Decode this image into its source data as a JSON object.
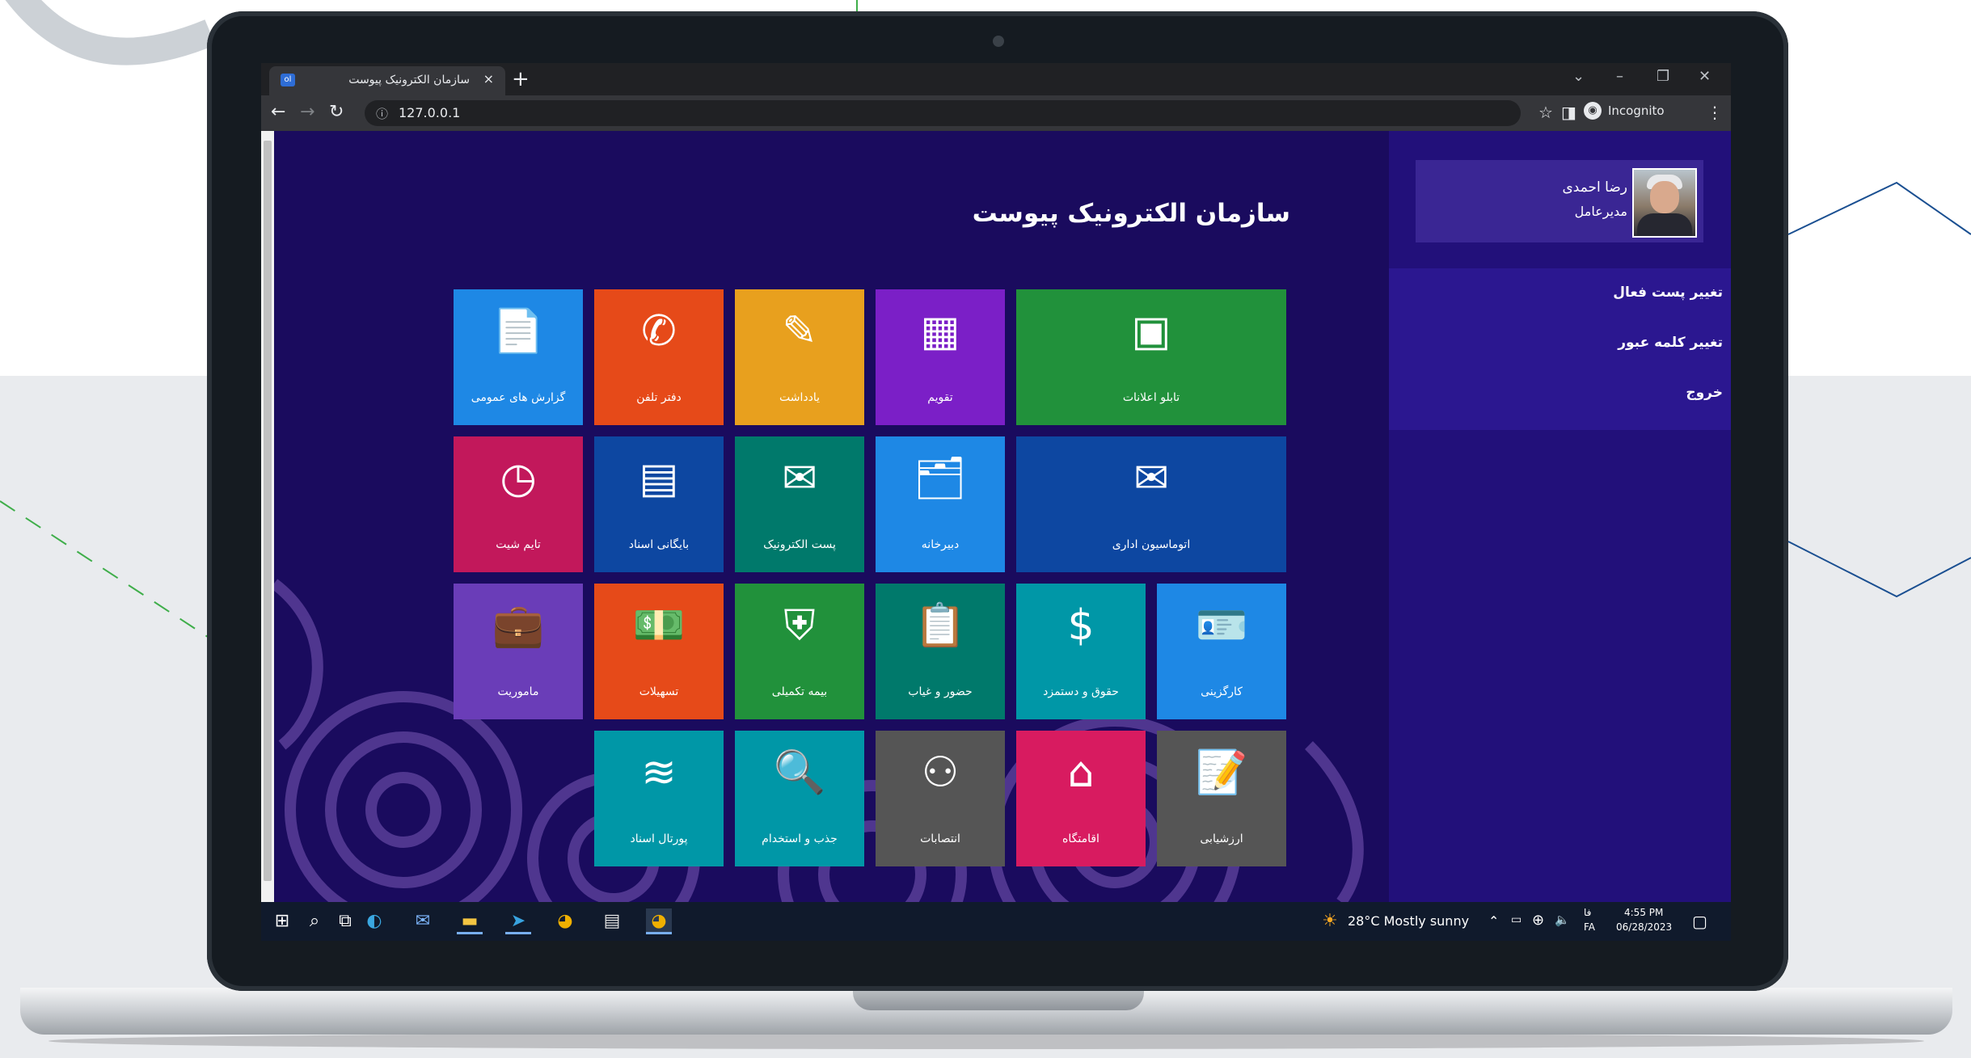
{
  "browser": {
    "tab_title": "سازمان الکترونیک پیوست",
    "tab_favicon": "ol",
    "tab_close": "×",
    "new_tab": "+",
    "url": "127.0.0.1",
    "incognito_label": "Incognito"
  },
  "page": {
    "title": "سازمان الکترونیک پیوست"
  },
  "user": {
    "name": "رضا احمدی",
    "role": "مدیرعامل"
  },
  "side_menu": [
    {
      "label": "تغییر پست فعال"
    },
    {
      "label": "تغییر کلمه عبور"
    },
    {
      "label": "خروج"
    }
  ],
  "tiles": [
    {
      "label": "گزارش های عمومی",
      "icon": "report-document-icon",
      "glyph": "📄",
      "color": "#1e88e5"
    },
    {
      "label": "دفتر تلفن",
      "icon": "phone-icon",
      "glyph": "✆",
      "color": "#e64a19"
    },
    {
      "label": "یادداشت",
      "icon": "note-edit-icon",
      "glyph": "✎",
      "color": "#e8a01e"
    },
    {
      "label": "تقویم",
      "icon": "calendar-icon",
      "glyph": "▦",
      "color": "#7b1fc7"
    },
    {
      "label": "تابلو اعلانات",
      "icon": "bulletin-board-icon",
      "glyph": "▣",
      "color": "#21913b"
    },
    {
      "label": "تایم شیت",
      "icon": "timesheet-clock-icon",
      "glyph": "◷",
      "color": "#c2185b"
    },
    {
      "label": "بایگانی اسناد",
      "icon": "file-cabinet-icon",
      "glyph": "▤",
      "color": "#0d47a1"
    },
    {
      "label": "پست الکترونیک",
      "icon": "email-image-icon",
      "glyph": "✉",
      "color": "#00796b"
    },
    {
      "label": "دبیرخانه",
      "icon": "documents-folder-icon",
      "glyph": "🗂",
      "color": "#1e88e5"
    },
    {
      "label": "اتوماسیون اداری",
      "icon": "envelope-icon",
      "glyph": "✉",
      "color": "#0d47a1"
    },
    {
      "label": "ماموریت",
      "icon": "briefcase-icon",
      "glyph": "💼",
      "color": "#6a3db8"
    },
    {
      "label": "تسهیلات",
      "icon": "money-hand-icon",
      "glyph": "💵",
      "color": "#e64a19"
    },
    {
      "label": "بیمه تکمیلی",
      "icon": "health-shield-icon",
      "glyph": "⛨",
      "color": "#21913b"
    },
    {
      "label": "حضور و غیاب",
      "icon": "attendance-clipboard-icon",
      "glyph": "📋",
      "color": "#00796b"
    },
    {
      "label": "حقوق و دستمزد",
      "icon": "salary-person-icon",
      "glyph": "$",
      "color": "#0097a7"
    },
    {
      "label": "کارگزینی",
      "icon": "id-card-icon",
      "glyph": "🪪",
      "color": "#1e88e5"
    },
    {
      "label": "پورتال اسناد",
      "icon": "layers-icon",
      "glyph": "≋",
      "color": "#0097a7"
    },
    {
      "label": "جذب و استخدام",
      "icon": "recruitment-search-icon",
      "glyph": "🔍",
      "color": "#0097a7"
    },
    {
      "label": "انتصابات",
      "icon": "org-chart-icon",
      "glyph": "⚇",
      "color": "#555555"
    },
    {
      "label": "اقامتگاه",
      "icon": "home-icon",
      "glyph": "⌂",
      "color": "#d81b60"
    },
    {
      "label": "ارزشیابی",
      "icon": "evaluation-clipboard-icon",
      "glyph": "📝",
      "color": "#555555"
    }
  ],
  "taskbar": {
    "weather": "28°C  Mostly sunny",
    "lang_top": "فا",
    "lang_bottom": "FA",
    "time": "4:55 PM",
    "date": "06/28/2023"
  },
  "colors": {
    "page_bg": "#1a0b5e",
    "right_panel": "#22107a",
    "taskbar": "#101a2c"
  }
}
